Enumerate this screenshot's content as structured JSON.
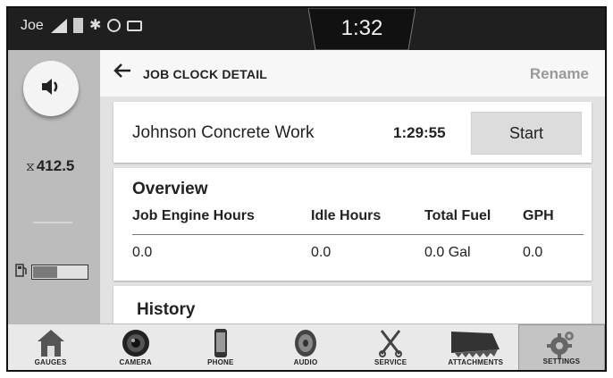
{
  "status": {
    "user": "Joe",
    "time": "1:32"
  },
  "left_rail": {
    "volume_icon": "speaker-icon",
    "engine_hours": "412.5",
    "hourglass_icon": "hourglass-icon",
    "fuel_icon": "fuel-pump-icon",
    "fuel_level": 0.45
  },
  "header": {
    "title": "JOB CLOCK DETAIL",
    "rename_label": "Rename"
  },
  "job": {
    "name": "Johnson Concrete Work",
    "elapsed": "1:29:55",
    "start_label": "Start"
  },
  "overview": {
    "title": "Overview",
    "columns": [
      "Job Engine Hours",
      "Idle Hours",
      "Total Fuel",
      "GPH"
    ],
    "values": [
      "0.0",
      "0.0",
      "0.0 Gal",
      "0.0"
    ]
  },
  "history": {
    "title": "History"
  },
  "nav": {
    "items": [
      {
        "label": "GAUGES",
        "icon": "gauges-icon"
      },
      {
        "label": "CAMERA",
        "icon": "camera-icon"
      },
      {
        "label": "PHONE",
        "icon": "phone-icon"
      },
      {
        "label": "AUDIO",
        "icon": "audio-icon"
      },
      {
        "label": "SERVICE",
        "icon": "service-icon"
      },
      {
        "label": "ATTACHMENTS",
        "icon": "attachments-icon"
      },
      {
        "label": "SETTINGS",
        "icon": "settings-icon"
      }
    ],
    "active": "SETTINGS"
  }
}
